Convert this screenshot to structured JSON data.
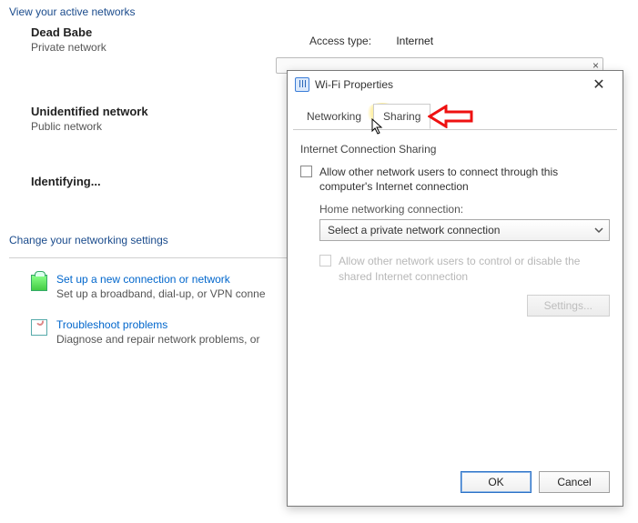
{
  "back": {
    "section_active": "View your active networks",
    "net1_name": "Dead Babe",
    "net1_sub": "Private network",
    "access_type_label": "Access type:",
    "access_type_value": "Internet",
    "net2_name": "Unidentified network",
    "net2_sub": "Public network",
    "net3_name": "Identifying...",
    "section_change": "Change your networking settings",
    "link1_title": "Set up a new connection or network",
    "link1_desc": "Set up a broadband, dial-up, or VPN conne",
    "link2_title": "Troubleshoot problems",
    "link2_desc": "Diagnose and repair network problems, or"
  },
  "dialog": {
    "title": "Wi-Fi Properties",
    "tab_networking": "Networking",
    "tab_sharing": "Sharing",
    "group_title": "Internet Connection Sharing",
    "chk1_label": "Allow other network users to connect through this computer's Internet connection",
    "home_conn_label": "Home networking connection:",
    "select_value": "Select a private network connection",
    "chk2_label": "Allow other network users to control or disable the shared Internet connection",
    "settings_btn": "Settings...",
    "ok": "OK",
    "cancel": "Cancel"
  }
}
